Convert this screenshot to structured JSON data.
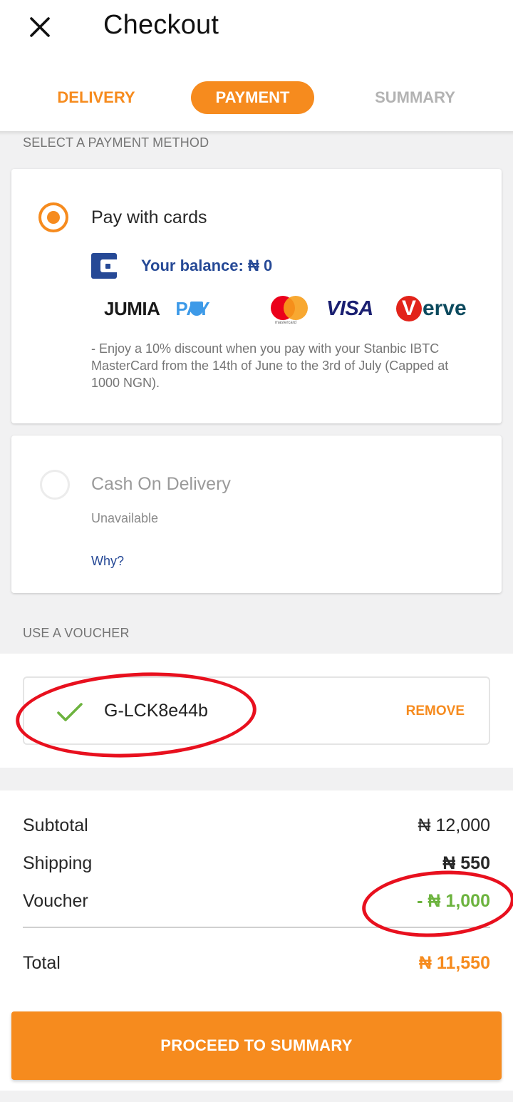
{
  "header": {
    "title": "Checkout",
    "close_icon": "close-icon",
    "steps": [
      {
        "label": "DELIVERY",
        "state": "done"
      },
      {
        "label": "PAYMENT",
        "state": "active"
      },
      {
        "label": "SUMMARY",
        "state": "pending"
      }
    ]
  },
  "payment": {
    "section_label": "SELECT A PAYMENT METHOD",
    "options": [
      {
        "title": "Pay with cards",
        "selected": true,
        "balance": "Your balance: ₦ 0",
        "brands": [
          "JUMIA",
          "PAY",
          "mastercard",
          "VISA",
          "V",
          "erve"
        ],
        "promo": "- Enjoy a 10% discount when you pay with your Stanbic IBTC MasterCard from the 14th of June to the 3rd of July (Capped at 1000 NGN)."
      },
      {
        "title": "Cash On Delivery",
        "selected": false,
        "status": "Unavailable",
        "why_link": "Why?"
      }
    ]
  },
  "voucher": {
    "section_label": "USE A VOUCHER",
    "code": "G-LCK8e44b",
    "remove_label": "REMOVE"
  },
  "totals": {
    "subtotal_label": "Subtotal",
    "subtotal_value": "₦ 12,000",
    "shipping_label": "Shipping",
    "shipping_value": "₦ 550",
    "voucher_label": "Voucher",
    "voucher_value": "- ₦ 1,000",
    "total_label": "Total",
    "total_value": "₦ 11,550"
  },
  "cta": {
    "label": "PROCEED TO SUMMARY"
  },
  "colors": {
    "accent": "#f68b1e",
    "link": "#264996",
    "discount": "#6cb33e",
    "annotation": "#e8101e"
  }
}
